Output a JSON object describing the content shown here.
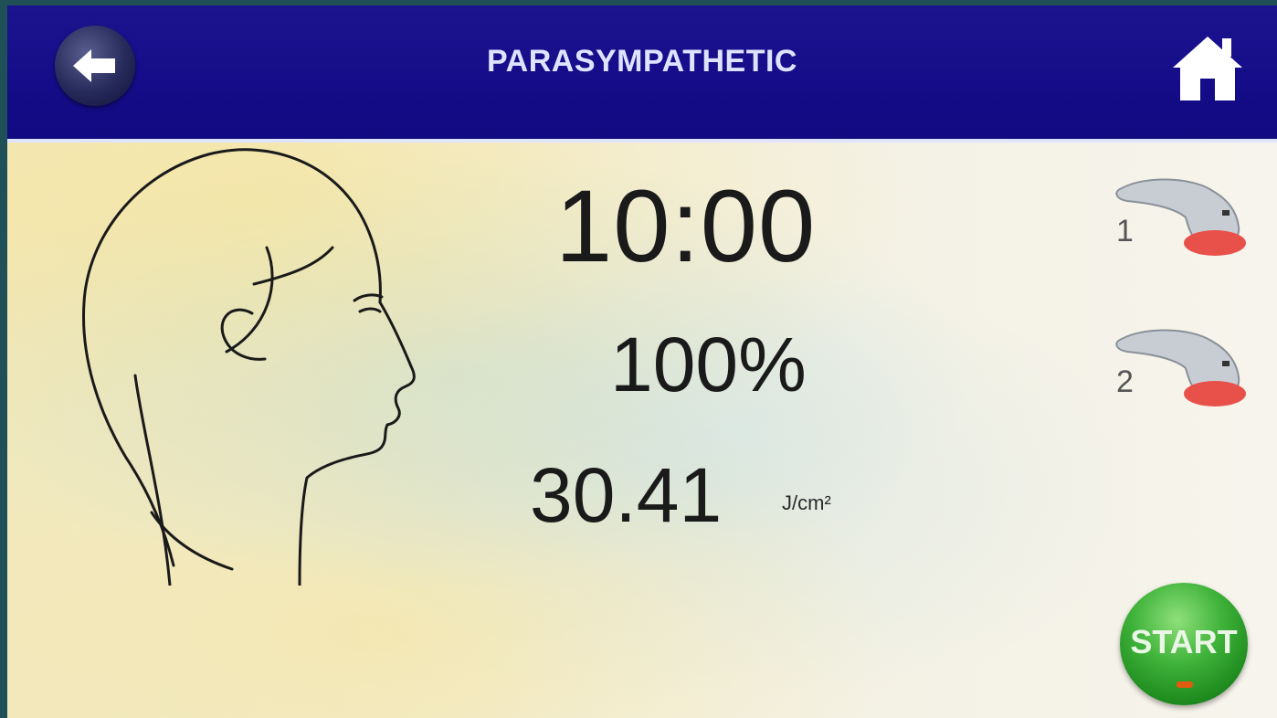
{
  "header": {
    "title": "PARASYMPATHETIC",
    "back_icon": "arrow-left-icon",
    "home_icon": "home-icon"
  },
  "treatment": {
    "time": "10:00",
    "power": "100%",
    "dose_value": "30.41",
    "dose_unit": "J/cm²"
  },
  "handpieces": [
    {
      "number": "1",
      "icon": "handpiece-icon"
    },
    {
      "number": "2",
      "icon": "handpiece-icon"
    }
  ],
  "actions": {
    "start_label": "START"
  },
  "colors": {
    "header_bg": "#140c88",
    "title_text": "#dfe3ff",
    "start_green": "#2fa02c",
    "target_spot_red": "#e8284a",
    "handpiece_tip_red": "#e8504a"
  }
}
